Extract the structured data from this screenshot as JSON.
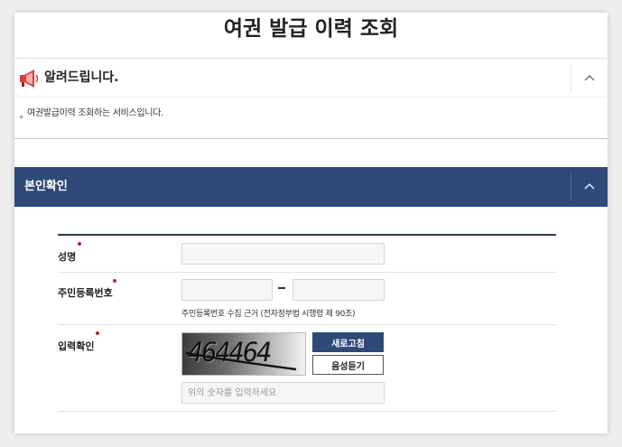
{
  "page": {
    "title": "여권 발급 이력 조회"
  },
  "notice": {
    "title": "알려드립니다.",
    "text": "여권발급이력 조회하는 서비스입니다.",
    "icon": "megaphone-icon",
    "toggle_icon": "chevron-up-icon"
  },
  "verify": {
    "title": "본인확인",
    "toggle_icon": "chevron-up-icon",
    "accent_color": "#2f4a79"
  },
  "form": {
    "name": {
      "label": "성명",
      "value": ""
    },
    "rrn": {
      "label": "주민등록번호",
      "first_value": "",
      "second_value": "",
      "note": "주민등록번호 수집 근거 (전자정부법 시행령 제 90조)"
    },
    "captcha": {
      "label": "입력확인",
      "image_text": "464464",
      "refresh_label": "새로고침",
      "audio_label": "음성듣기",
      "placeholder": "위의 숫자를 입력하세요",
      "value": ""
    },
    "required_color": "#d8152a"
  }
}
